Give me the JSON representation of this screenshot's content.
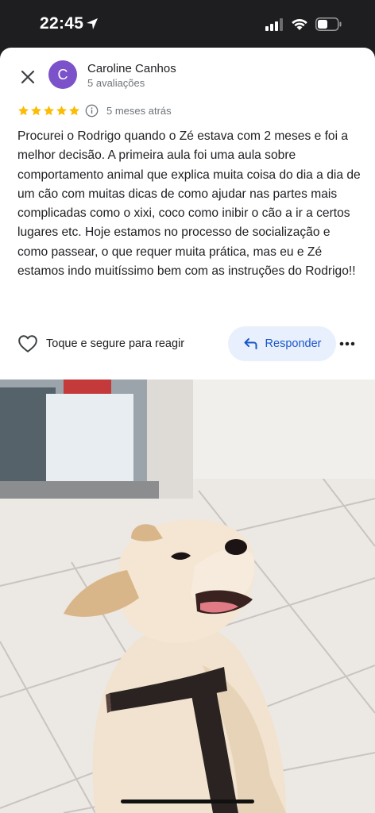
{
  "status_bar": {
    "time": "22:45",
    "icons": [
      "location-arrow-icon",
      "cellular-signal-icon",
      "wifi-icon",
      "battery-icon"
    ]
  },
  "review": {
    "author": {
      "name": "Caroline Canhos",
      "initial": "C",
      "reviews_count": "5 avaliações",
      "avatar_color": "#7b52c9"
    },
    "rating": 5,
    "star_color": "#fbbc04",
    "time_ago": "5 meses atrás",
    "text": "Procurei o Rodrigo quando o Zé estava com 2 meses e foi a melhor decisão. A primeira aula foi uma aula sobre comportamento animal que explica muita coisa do dia a dia de um cão com muitas dicas de como ajudar nas partes mais complicadas como o xixi, coco como inibir o cão a ir a certos lugares etc. Hoje estamos no processo de socialização e como passear, o que requer muita prática, mas eu e Zé estamos indo muitíssimo bem com as instruções do Rodrigo!!"
  },
  "actions": {
    "react_label": "Toque e segure para reagir",
    "reply_label": "Responder",
    "reply_color": "#1a56c9"
  },
  "photo": {
    "subject": "puppy-with-harness"
  }
}
